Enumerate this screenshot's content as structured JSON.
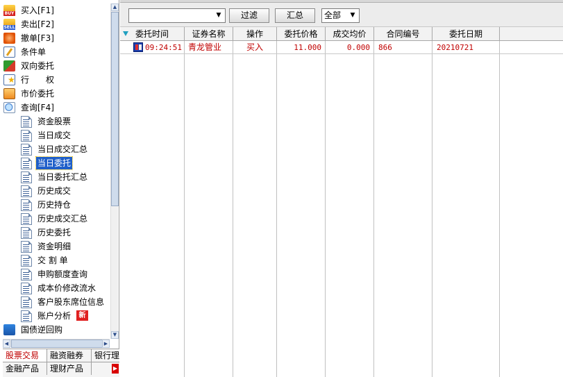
{
  "nav": {
    "items": [
      {
        "label": "买入[F1]",
        "icon": "buy-icon",
        "name": "nav-buy"
      },
      {
        "label": "卖出[F2]",
        "icon": "sell-icon",
        "name": "nav-sell"
      },
      {
        "label": "撤单[F3]",
        "icon": "cancel-order-icon",
        "name": "nav-cancel"
      },
      {
        "label": "条件单",
        "icon": "conditional-order-icon",
        "name": "nav-conditional"
      },
      {
        "label": "双向委托",
        "icon": "dual-order-icon",
        "name": "nav-dual"
      },
      {
        "label": "行　　权",
        "icon": "exercise-icon",
        "name": "nav-exercise"
      },
      {
        "label": "市价委托",
        "icon": "market-order-icon",
        "name": "nav-market"
      },
      {
        "label": "查询[F4]",
        "icon": "query-icon",
        "name": "nav-query"
      }
    ],
    "query_children": [
      "资金股票",
      "当日成交",
      "当日成交汇总",
      "当日委托",
      "当日委托汇总",
      "历史成交",
      "历史持仓",
      "历史成交汇总",
      "历史委托",
      "资金明细",
      "交 割 单",
      "申购额度查询",
      "成本价修改流水",
      "客户股东席位信息",
      "账户分析"
    ],
    "selected": "当日委托",
    "new_badge": "新",
    "last_item": {
      "label": "国债逆回购",
      "icon": "bond-repo-icon"
    }
  },
  "tabs": {
    "row1": [
      "股票交易",
      "融资融券",
      "银行理"
    ],
    "row1_active": "股票交易",
    "row2": [
      "金融产品",
      "理财产品"
    ]
  },
  "toolbar": {
    "stock_combo_value": "",
    "filter_label": "过滤",
    "summary_label": "汇总",
    "scope_value": "全部"
  },
  "table": {
    "columns": [
      "委托时间",
      "证券名称",
      "操作",
      "委托价格",
      "成交均价",
      "合同编号",
      "委托日期"
    ],
    "rows": [
      {
        "time": "09:24:51",
        "name": "青龙管业",
        "op": "买入",
        "price": "11.000",
        "avg": "0.000",
        "contract": "866",
        "date": "20210721"
      }
    ]
  },
  "colors": {
    "accent_red": "#c00000",
    "selected_bg": "#1f5fc9"
  }
}
